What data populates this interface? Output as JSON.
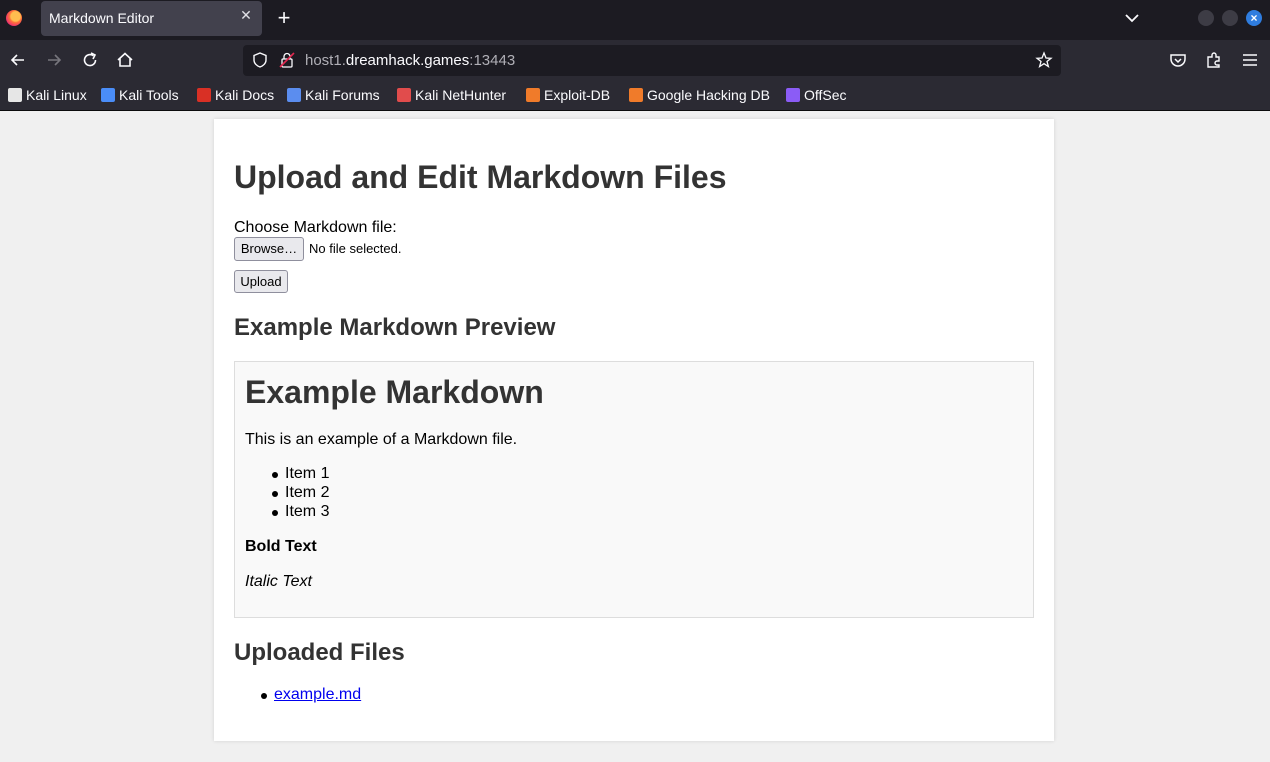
{
  "browser": {
    "tab_title": "Markdown Editor",
    "url_prefix": "host1.",
    "url_host": "dreamhack.games",
    "url_port": ":13443",
    "bookmarks": [
      {
        "label": "Kali Linux",
        "icon": "kali-dragon-icon",
        "color": "#e6e6e6"
      },
      {
        "label": "Kali Tools",
        "icon": "kali-tools-icon",
        "color": "#4a8df8"
      },
      {
        "label": "Kali Docs",
        "icon": "kali-docs-icon",
        "color": "#d93025"
      },
      {
        "label": "Kali Forums",
        "icon": "kali-forums-icon",
        "color": "#5b8def"
      },
      {
        "label": "Kali NetHunter",
        "icon": "nethunter-icon",
        "color": "#e14c4c"
      },
      {
        "label": "Exploit-DB",
        "icon": "exploit-db-icon",
        "color": "#f07b2a"
      },
      {
        "label": "Google Hacking DB",
        "icon": "ghdb-icon",
        "color": "#f07b2a"
      },
      {
        "label": "OffSec",
        "icon": "offsec-icon",
        "color": "#8b5cf6"
      }
    ]
  },
  "page": {
    "title": "Upload and Edit Markdown Files",
    "file_label": "Choose Markdown file:",
    "browse_label": "Browse…",
    "file_status": "No file selected.",
    "upload_label": "Upload",
    "preview_heading": "Example Markdown Preview",
    "preview": {
      "heading": "Example Markdown",
      "paragraph": "This is an example of a Markdown file.",
      "items": [
        "Item 1",
        "Item 2",
        "Item 3"
      ],
      "bold": "Bold Text",
      "italic": "Italic Text"
    },
    "uploaded_heading": "Uploaded Files",
    "uploaded_files": [
      "example.md"
    ]
  },
  "colors": {
    "page_bg": "#f0f0f0",
    "card_bg": "#ffffff",
    "heading": "#333333",
    "link": "#0000ee",
    "titlebar": "#1c1b22",
    "toolbar": "#2b2a33"
  }
}
